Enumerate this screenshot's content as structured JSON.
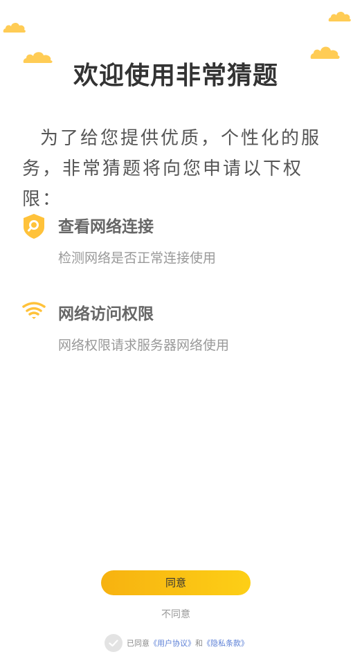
{
  "header": {
    "title": "欢迎使用非常猜题"
  },
  "intro": {
    "text": "为了给您提供优质，个性化的服务，非常猜题将向您申请以下权限："
  },
  "permissions": [
    {
      "icon": "shield-search-icon",
      "title": "查看网络连接",
      "description": "检测网络是否正常连接使用"
    },
    {
      "icon": "wifi-icon",
      "title": "网络访问权限",
      "description": "网络权限请求服务器网络使用"
    }
  ],
  "actions": {
    "agree_label": "同意",
    "disagree_label": "不同意"
  },
  "consent": {
    "prefix": "已同意",
    "user_agreement": "《用户协议》",
    "and": "和",
    "privacy_policy": "《隐私条款》",
    "checked": true
  },
  "colors": {
    "accent": "#F9BF12",
    "cloud": "#FFCC55",
    "link": "#5B7FD6",
    "title": "#333333"
  }
}
